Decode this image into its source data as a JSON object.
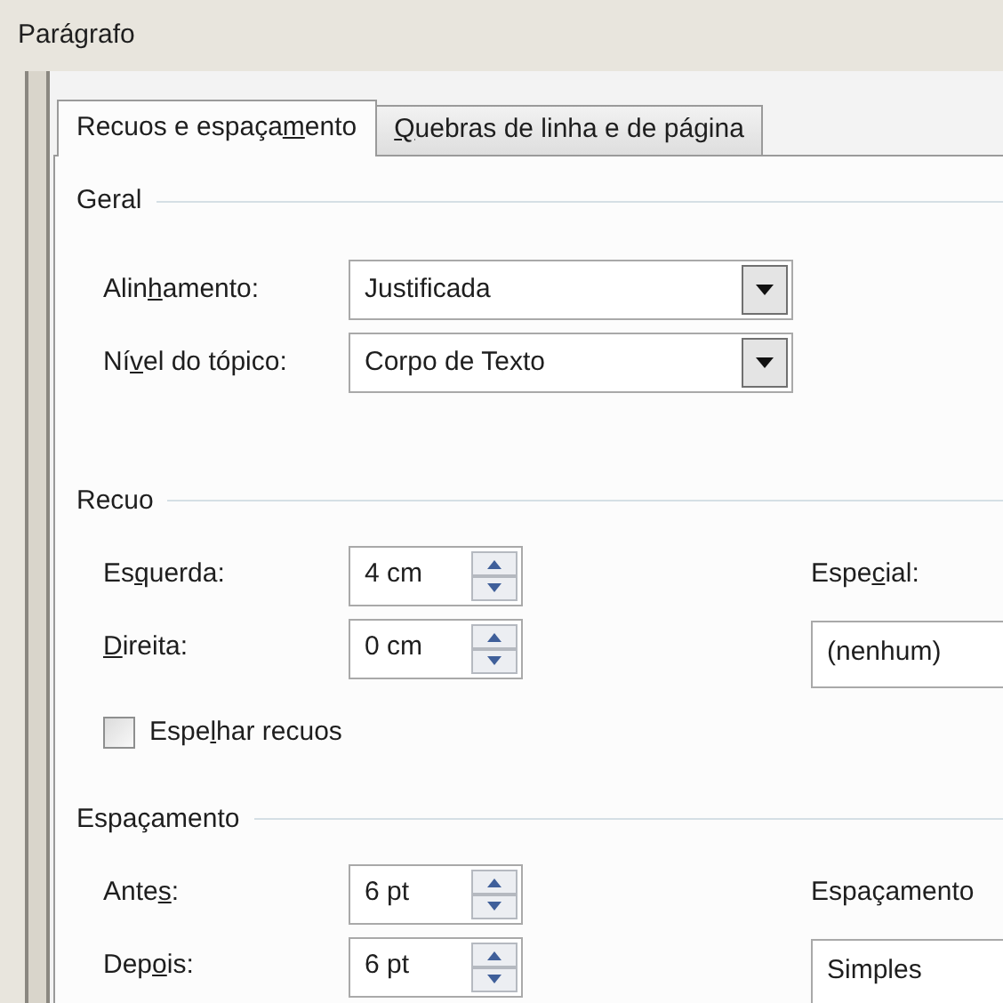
{
  "window": {
    "title": "Parágrafo"
  },
  "tabs": [
    {
      "label": {
        "pre": "Recuos e espaça",
        "key": "m",
        "post": "ento"
      },
      "selected": true
    },
    {
      "label": {
        "key": "Q",
        "post": "uebras de linha e de página"
      },
      "selected": false
    }
  ],
  "sections": [
    {
      "title": "Geral",
      "rows": [
        {
          "label": {
            "pre": "Alin",
            "key": "h",
            "post": "amento:"
          },
          "field": {
            "kind": "combo",
            "value": "Justificada"
          }
        },
        {
          "label": {
            "pre": "Ní",
            "key": "v",
            "post": "el do tópico:"
          },
          "field": {
            "kind": "combo",
            "value": "Corpo de Texto"
          }
        }
      ]
    },
    {
      "title": "Recuo",
      "rows": [
        {
          "label": {
            "pre": "Es",
            "key": "q",
            "post": "uerda:"
          },
          "field": {
            "kind": "spin",
            "value": "4 cm"
          },
          "right": {
            "kind": "label",
            "label": {
              "pre": "Espe",
              "key": "c",
              "post": "ial:"
            }
          }
        },
        {
          "label": {
            "key": "D",
            "post": "ireita:"
          },
          "field": {
            "kind": "spin",
            "value": "0 cm"
          },
          "right": {
            "kind": "field",
            "value": "(nenhum)"
          }
        }
      ],
      "checkbox": {
        "label": {
          "pre": "Espe",
          "key": "l",
          "post": "har recuos"
        },
        "checked": false
      }
    },
    {
      "title": "Espaçamento",
      "rows": [
        {
          "label": {
            "pre": "Ante",
            "key": "s",
            "post": ":"
          },
          "field": {
            "kind": "spin",
            "value": "6 pt"
          },
          "right": {
            "kind": "label",
            "label": {
              "pre": "Espaçamento"
            }
          }
        },
        {
          "label": {
            "pre": "Dep",
            "key": "o",
            "post": "is:"
          },
          "field": {
            "kind": "spin",
            "value": "6 pt"
          },
          "right": {
            "kind": "field",
            "value": "Simples"
          }
        }
      ]
    }
  ]
}
